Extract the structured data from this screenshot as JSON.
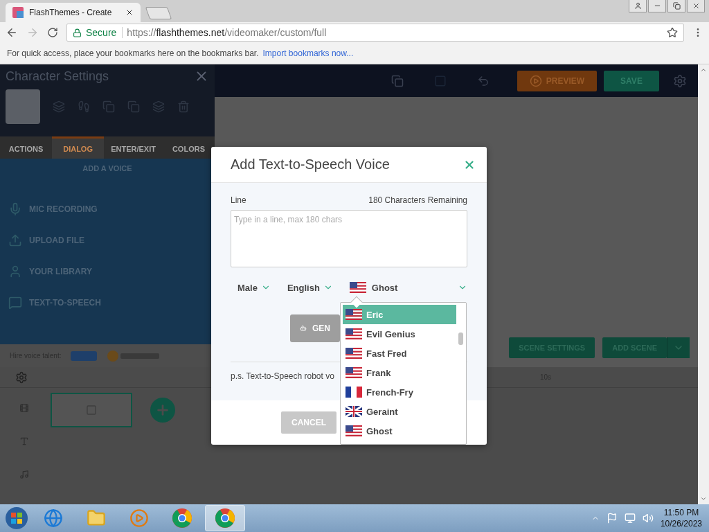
{
  "browser": {
    "tab_title": "FlashThemes - Create",
    "secure_label": "Secure",
    "url_scheme": "https://",
    "url_host": "flashthemes.net",
    "url_path": "/videomaker/custom/full",
    "bookmarks_hint": "For quick access, place your bookmarks here on the bookmarks bar.",
    "bookmarks_link": "Import bookmarks now..."
  },
  "character_panel": {
    "title": "Character Settings",
    "tabs": [
      {
        "label": "ACTIONS",
        "selected": false
      },
      {
        "label": "DIALOG",
        "selected": true
      },
      {
        "label": "ENTER/EXIT",
        "selected": false
      },
      {
        "label": "COLORS",
        "selected": false
      }
    ],
    "section_title": "ADD A VOICE",
    "voice_sources": [
      {
        "label": "MIC RECORDING",
        "kind": "mic"
      },
      {
        "label": "UPLOAD FILE",
        "kind": "upload"
      },
      {
        "label": "YOUR LIBRARY",
        "kind": "library"
      },
      {
        "label": "TEXT-TO-SPEECH",
        "kind": "tts"
      }
    ],
    "hire_label": "Hire voice talent:"
  },
  "toolbar": {
    "buttons": [
      {
        "label": "PREVIEW",
        "kind": "preview"
      },
      {
        "label": "SAVE",
        "kind": "save"
      }
    ]
  },
  "scene_buttons": [
    {
      "label": "SCENE SETTINGS",
      "kind": "settings"
    },
    {
      "label": "ADD SCENE",
      "kind": "add"
    }
  ],
  "timeline": {
    "time_marker": "10s"
  },
  "dialog": {
    "title": "Add Text-to-Speech Voice",
    "line_label": "Line",
    "remaining": "180 Characters Remaining",
    "placeholder": "Type in a line, max 180 chars",
    "gender": "Male",
    "language": "English",
    "voice": {
      "name": "Ghost",
      "kind": "us"
    },
    "generate_label": "GEN",
    "note": "p.s. Text-to-Speech robot vo",
    "cancel_label": "CANCEL",
    "voice_options": [
      {
        "name": "Eric",
        "kind": "us",
        "selected": true
      },
      {
        "name": "Evil Genius",
        "kind": "us",
        "selected": false
      },
      {
        "name": "Fast Fred",
        "kind": "us",
        "selected": false
      },
      {
        "name": "Frank",
        "kind": "us",
        "selected": false
      },
      {
        "name": "French-Fry",
        "kind": "fr",
        "selected": false
      },
      {
        "name": "Geraint",
        "kind": "uk",
        "selected": false
      },
      {
        "name": "Ghost",
        "kind": "us",
        "selected": false
      }
    ]
  },
  "taskbar": {
    "apps": [
      {
        "kind": "ie",
        "selected": false
      },
      {
        "kind": "explorer",
        "selected": false
      },
      {
        "kind": "media",
        "selected": false
      },
      {
        "kind": "chrome",
        "selected": false
      },
      {
        "kind": "chrome",
        "selected": true
      }
    ],
    "time": "11:50 PM",
    "date": "10/26/2023"
  }
}
